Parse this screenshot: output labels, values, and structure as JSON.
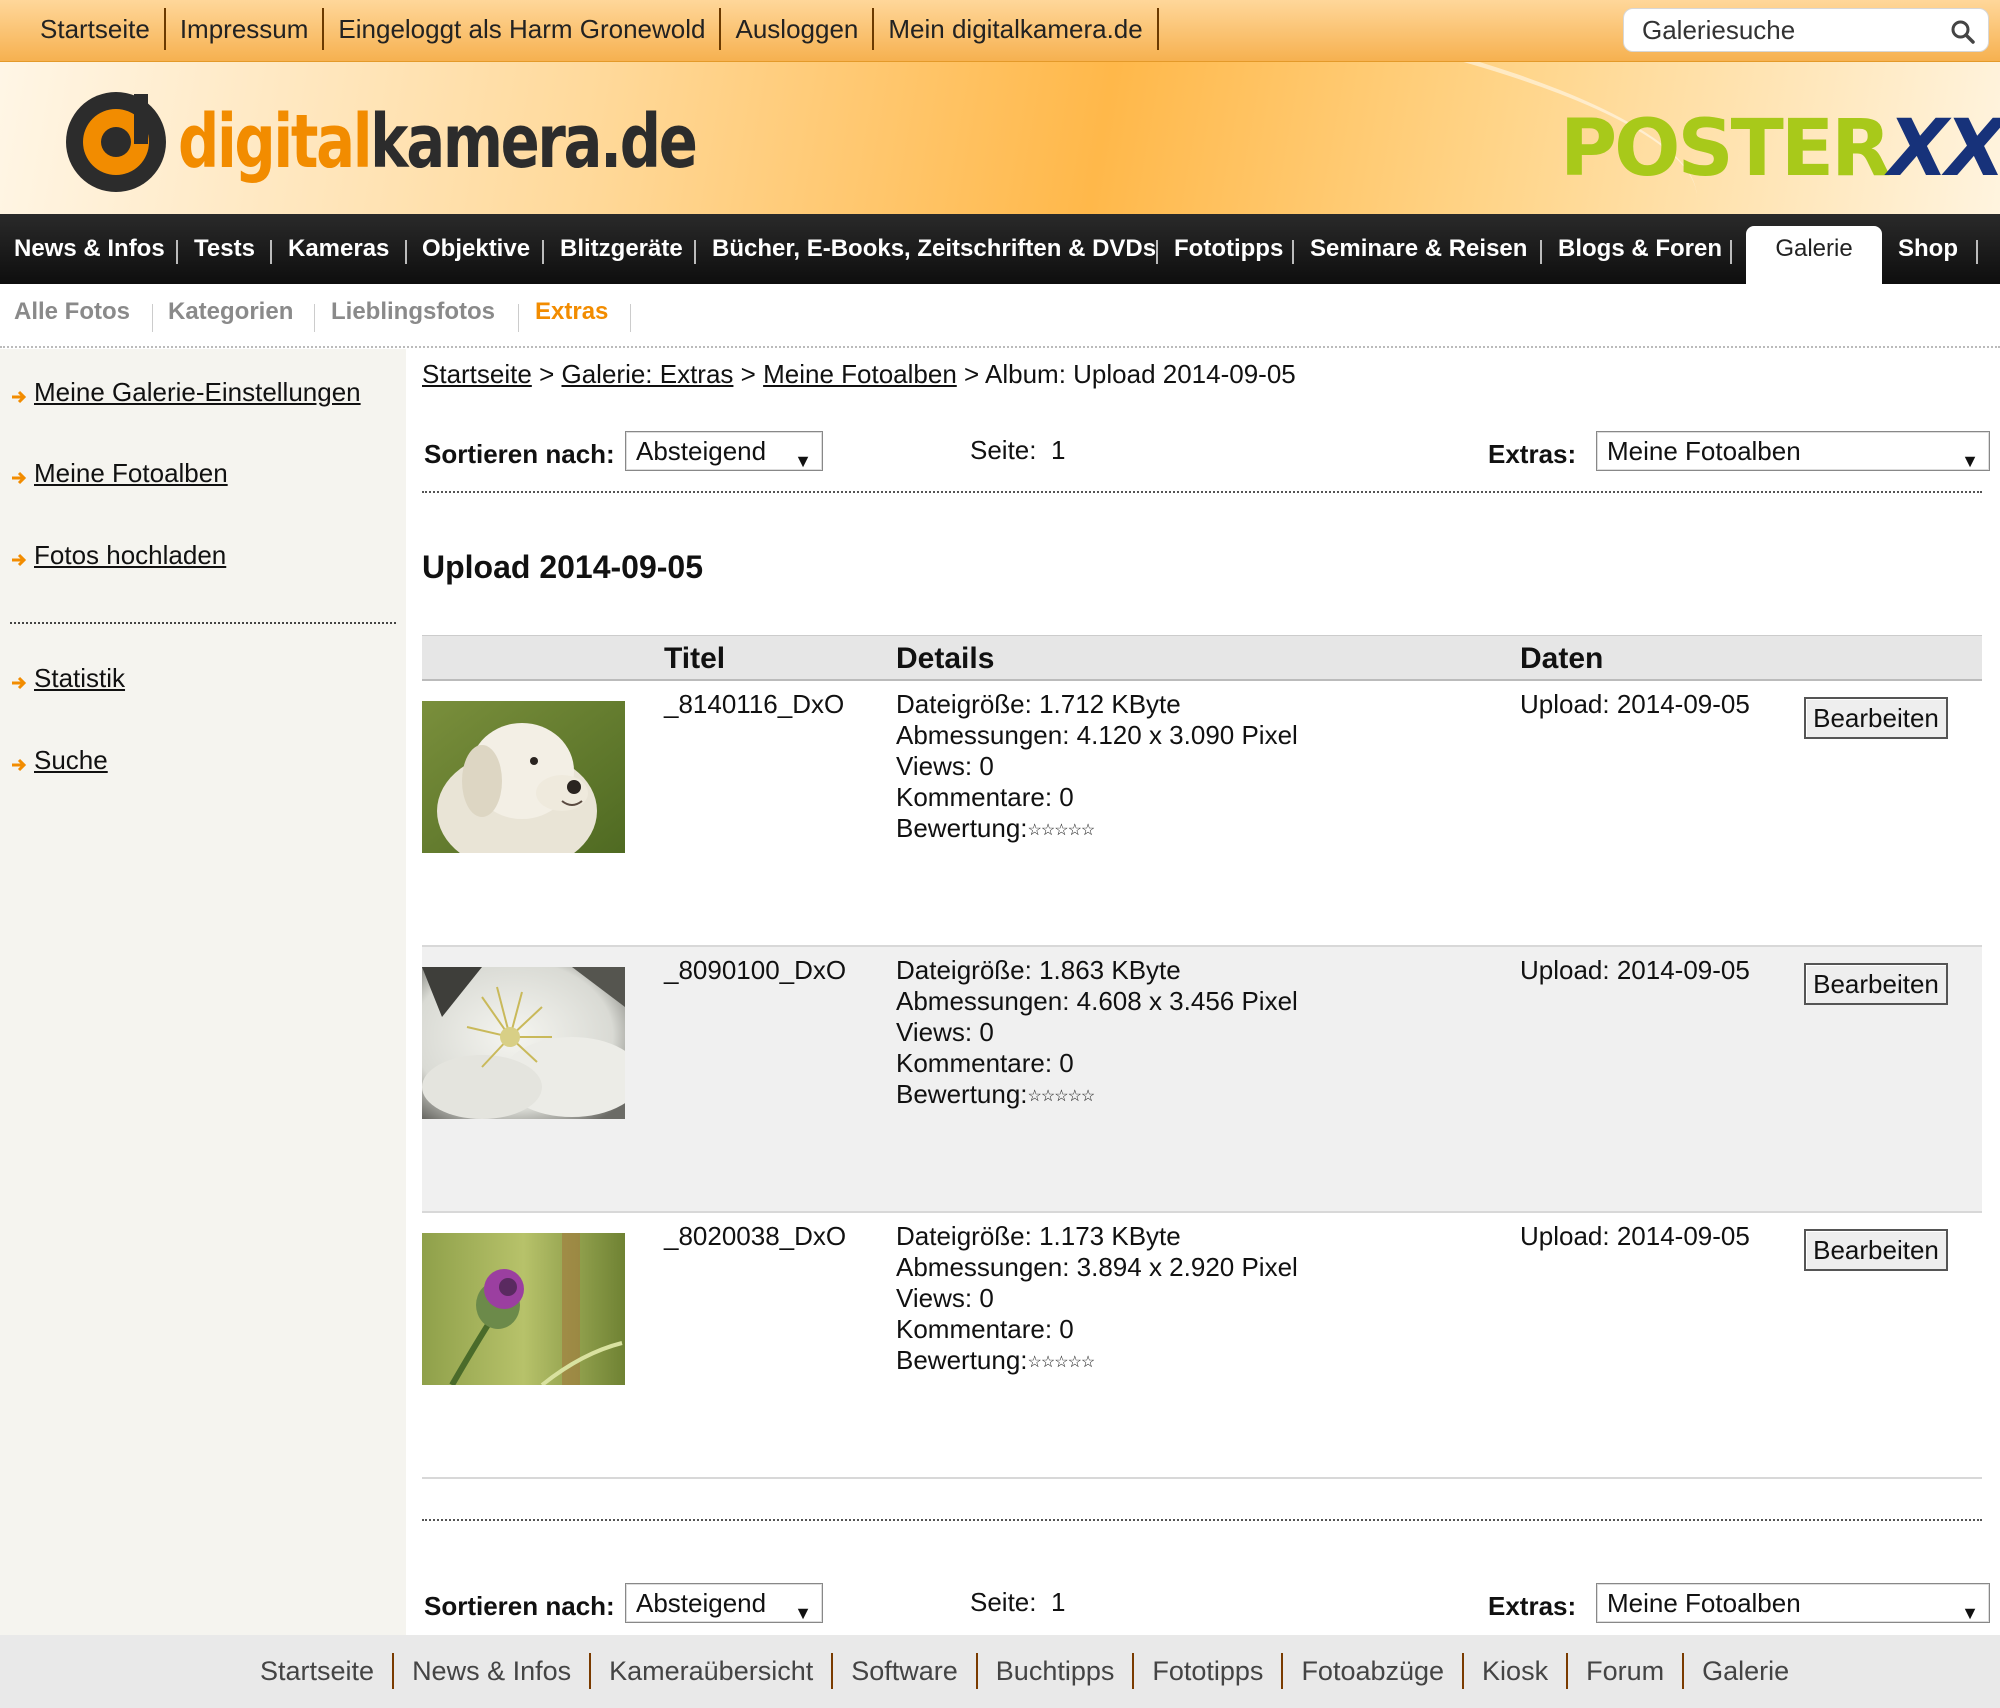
{
  "topbar": {
    "links": [
      "Startseite",
      "Impressum",
      "Eingeloggt als Harm Gronewold",
      "Ausloggen",
      "Mein digitalkamera.de"
    ],
    "search_placeholder": "Galeriesuche"
  },
  "header": {
    "logo_part1": "digital",
    "logo_part2": "kamera.de",
    "ad_part1": "POSTER",
    "ad_part2": "XXL"
  },
  "mainnav": {
    "items": [
      "News & Infos",
      "Tests",
      "Kameras",
      "Objektive",
      "Blitzgeräte",
      "Bücher, E-Books, Zeitschriften & DVDs",
      "Fototipps",
      "Seminare & Reisen",
      "Blogs & Foren",
      "Galerie",
      "Shop"
    ],
    "active": "Galerie"
  },
  "subnav": {
    "items": [
      "Alle Fotos",
      "Kategorien",
      "Lieblingsfotos",
      "Extras"
    ],
    "active": "Extras"
  },
  "sidebar": {
    "links": [
      "Meine Galerie-Einstellungen",
      "Meine Fotoalben",
      "Fotos hochladen",
      "Statistik",
      "Suche"
    ]
  },
  "breadcrumb": {
    "items": [
      "Startseite",
      "Galerie: Extras",
      "Meine Fotoalben"
    ],
    "separator": ">",
    "current": "Album: Upload 2014-09-05"
  },
  "controls": {
    "sort_label": "Sortieren nach:",
    "sort_value": "Absteigend",
    "page_label": "Seite:",
    "page_value": "1",
    "extras_label": "Extras:",
    "extras_value": "Meine Fotoalben"
  },
  "album": {
    "title": "Upload 2014-09-05",
    "columns": [
      "Titel",
      "Details",
      "Daten"
    ],
    "photos": [
      {
        "title": "_8140116_DxO",
        "size": "Dateigröße: 1.712 KByte",
        "dims": "Abmessungen: 4.120 x 3.090 Pixel",
        "views": "Views: 0",
        "comments": "Kommentare: 0",
        "rating_label": "Bewertung:",
        "rating": 0,
        "upload": "Upload: 2014-09-05",
        "edit": "Bearbeiten"
      },
      {
        "title": "_8090100_DxO",
        "size": "Dateigröße: 1.863 KByte",
        "dims": "Abmessungen: 4.608 x 3.456 Pixel",
        "views": "Views: 0",
        "comments": "Kommentare: 0",
        "rating_label": "Bewertung:",
        "rating": 0,
        "upload": "Upload: 2014-09-05",
        "edit": "Bearbeiten"
      },
      {
        "title": "_8020038_DxO",
        "size": "Dateigröße: 1.173 KByte",
        "dims": "Abmessungen: 3.894 x 2.920 Pixel",
        "views": "Views: 0",
        "comments": "Kommentare: 0",
        "rating_label": "Bewertung:",
        "rating": 0,
        "upload": "Upload: 2014-09-05",
        "edit": "Bearbeiten"
      }
    ]
  },
  "footer": {
    "links": [
      "Startseite",
      "News & Infos",
      "Kameraübersicht",
      "Software",
      "Buchtipps",
      "Fototipps",
      "Fotoabzüge",
      "Kiosk",
      "Forum",
      "Galerie"
    ]
  },
  "colors": {
    "brand_orange": "#f28c00",
    "nav_dark": "#1a1a1a",
    "poster_green": "#a8c91a",
    "poster_blue": "#17327a"
  },
  "icons": [
    "search-icon",
    "arrow-right-icon",
    "chevron-down-icon",
    "star-icon"
  ]
}
